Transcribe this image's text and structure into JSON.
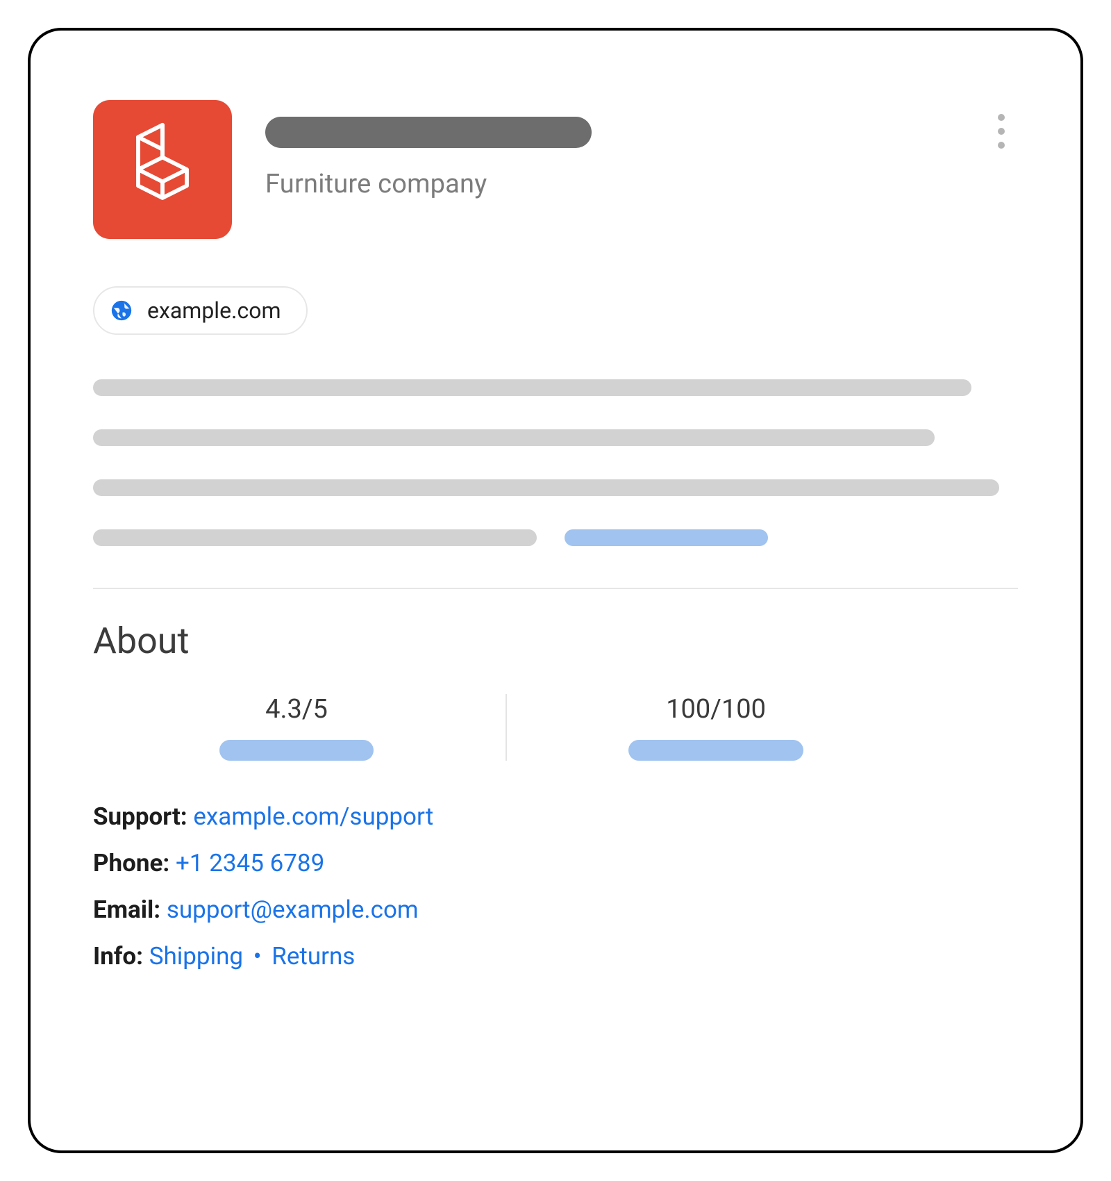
{
  "header": {
    "category": "Furniture company",
    "site_chip": "example.com"
  },
  "about": {
    "heading": "About",
    "rating": "4.3/5",
    "score": "100/100"
  },
  "contact": {
    "support_label": "Support:",
    "support_link": "example.com/support",
    "phone_label": "Phone:",
    "phone_link": "+1 2345 6789",
    "email_label": "Email:",
    "email_link": "support@example.com",
    "info_label": "Info:",
    "info_shipping": "Shipping",
    "info_separator": "•",
    "info_returns": "Returns"
  }
}
